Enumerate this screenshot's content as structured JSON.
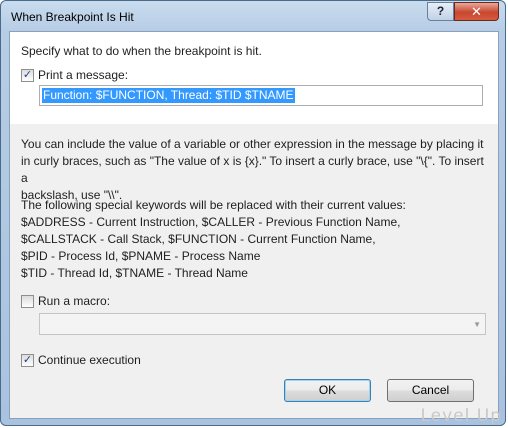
{
  "window": {
    "title": "When Breakpoint Is Hit",
    "help_glyph": "?",
    "close_glyph": "✕"
  },
  "intro": "Specify what to do when the breakpoint is hit.",
  "print_message": {
    "label": "Print a message:",
    "checked": true,
    "value": "Function: $FUNCTION, Thread: $TID $TNAME"
  },
  "help_text": {
    "lines": [
      "You can include the value of a variable or other expression in the message by placing it",
      "in curly braces, such as \"The value of x is {x}.\" To insert a curly brace, use \"\\{\". To insert a",
      "backslash, use \"\\\\\"."
    ]
  },
  "keywords": {
    "lines": [
      "The following special keywords will be replaced with their current values:",
      "$ADDRESS - Current Instruction, $CALLER - Previous Function Name,",
      "$CALLSTACK - Call Stack, $FUNCTION - Current Function Name,",
      "$PID - Process Id, $PNAME - Process Name",
      "$TID - Thread Id, $TNAME - Thread Name"
    ]
  },
  "run_macro": {
    "label": "Run a macro:",
    "checked": false,
    "selected": ""
  },
  "continue_execution": {
    "label": "Continue execution",
    "checked": true
  },
  "buttons": {
    "ok": "OK",
    "cancel": "Cancel"
  },
  "watermark": "Level Up"
}
